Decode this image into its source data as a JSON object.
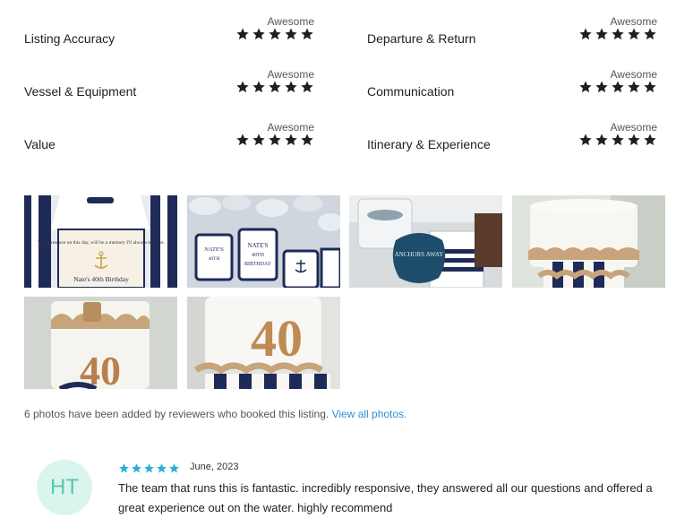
{
  "ratings": [
    {
      "label": "Listing Accuracy",
      "word": "Awesome",
      "stars": 5
    },
    {
      "label": "Departure & Return",
      "word": "Awesome",
      "stars": 5
    },
    {
      "label": "Vessel & Equipment",
      "word": "Awesome",
      "stars": 5
    },
    {
      "label": "Communication",
      "word": "Awesome",
      "stars": 5
    },
    {
      "label": "Value",
      "word": "Awesome",
      "stars": 5
    },
    {
      "label": "Itinerary & Experience",
      "word": "Awesome",
      "stars": 5
    }
  ],
  "photos": {
    "note": "6 photos have been added by reviewers who booked this listing.",
    "view_all": "View all photos.",
    "card_text": "Your presence on this day, will be a memory I'll always treasure.",
    "card_name": "Nate's 40th Birthday",
    "bottle_label": "NATE'S 40TH BIRTHDAY",
    "tag_text": "ANCHORS AWAY",
    "cake_number": "40"
  },
  "review": {
    "initials": "HT",
    "rating": 5,
    "date": "June, 2023",
    "text": "The team that runs this is fantastic. incredibly responsive, they answered all our questions and offered a great experience out on the water. highly recommend"
  },
  "colors": {
    "star_dark": "#1f1f1f",
    "star_review": "#2bb0d8",
    "link": "#2d8fd8",
    "avatar_bg": "#d9f5ee",
    "avatar_text": "#58c9b0"
  }
}
